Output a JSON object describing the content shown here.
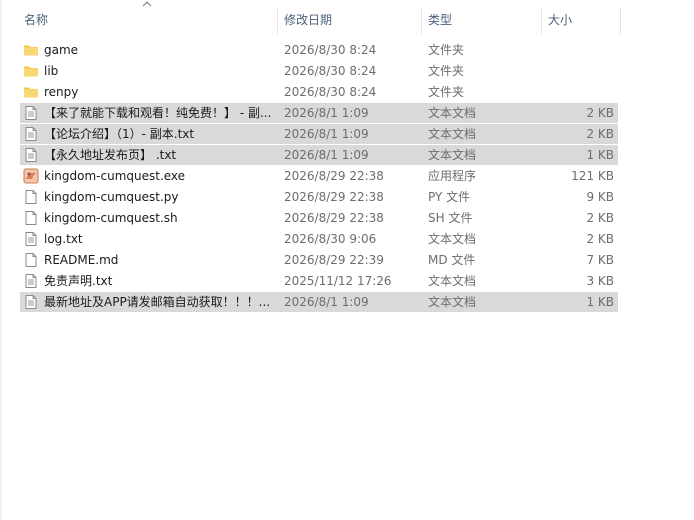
{
  "columns": {
    "name": "名称",
    "date": "修改日期",
    "type": "类型",
    "size": "大小"
  },
  "rows": [
    {
      "name": "game",
      "date": "2026/8/30 8:24",
      "type": "文件夹",
      "size": "",
      "icon": "folder-icon",
      "selected": false
    },
    {
      "name": "lib",
      "date": "2026/8/30 8:24",
      "type": "文件夹",
      "size": "",
      "icon": "folder-icon",
      "selected": false
    },
    {
      "name": "renpy",
      "date": "2026/8/30 8:24",
      "type": "文件夹",
      "size": "",
      "icon": "folder-icon",
      "selected": false
    },
    {
      "name": "【来了就能下载和观看！纯免费！】 - 副...",
      "date": "2026/8/1 1:09",
      "type": "文本文档",
      "size": "2 KB",
      "icon": "text-file-icon",
      "selected": true
    },
    {
      "name": "【论坛介绍】（1）- 副本.txt",
      "date": "2026/8/1 1:09",
      "type": "文本文档",
      "size": "2 KB",
      "icon": "text-file-icon",
      "selected": true
    },
    {
      "name": "【永久地址发布页】 .txt",
      "date": "2026/8/1 1:09",
      "type": "文本文档",
      "size": "1 KB",
      "icon": "text-file-icon",
      "selected": true
    },
    {
      "name": "kingdom-cumquest.exe",
      "date": "2026/8/29 22:38",
      "type": "应用程序",
      "size": "121 KB",
      "icon": "app-icon",
      "selected": false
    },
    {
      "name": "kingdom-cumquest.py",
      "date": "2026/8/29 22:38",
      "type": "PY 文件",
      "size": "9 KB",
      "icon": "file-icon",
      "selected": false
    },
    {
      "name": "kingdom-cumquest.sh",
      "date": "2026/8/29 22:38",
      "type": "SH 文件",
      "size": "2 KB",
      "icon": "file-icon",
      "selected": false
    },
    {
      "name": "log.txt",
      "date": "2026/8/30 9:06",
      "type": "文本文档",
      "size": "2 KB",
      "icon": "text-file-icon",
      "selected": false
    },
    {
      "name": "README.md",
      "date": "2026/8/29 22:39",
      "type": "MD 文件",
      "size": "7 KB",
      "icon": "file-icon",
      "selected": false
    },
    {
      "name": "免责声明.txt",
      "date": "2025/11/12 17:26",
      "type": "文本文档",
      "size": "3 KB",
      "icon": "text-file-icon",
      "selected": false
    },
    {
      "name": "最新地址及APP请发邮箱自动获取！！！...",
      "date": "2026/8/1 1:09",
      "type": "文本文档",
      "size": "1 KB",
      "icon": "text-file-icon",
      "selected": true
    }
  ],
  "colors": {
    "selected_bg": "#d9d9d9",
    "folder": "#f8d775",
    "header_text": "#4c607a"
  }
}
